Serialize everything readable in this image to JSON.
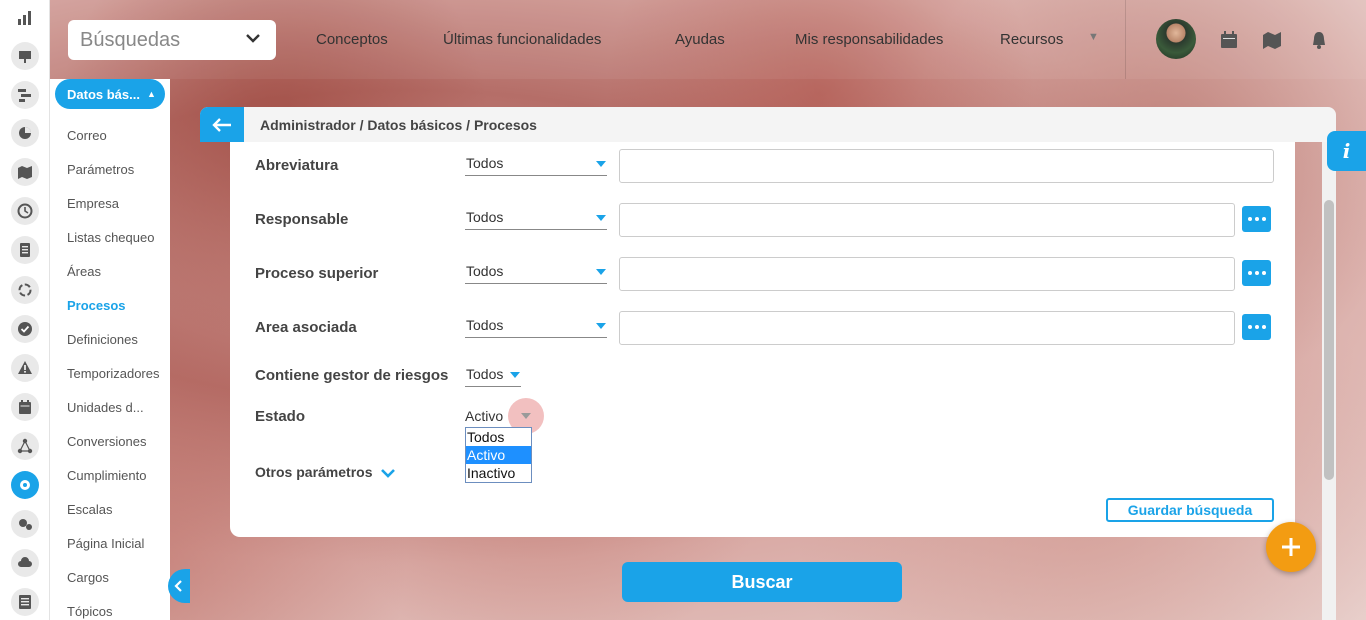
{
  "topbar": {
    "search_placeholder": "Búsquedas",
    "nav": [
      "Conceptos",
      "Últimas funcionalidades",
      "Ayudas",
      "Mis responsabilidades",
      "Recursos"
    ]
  },
  "submenu": {
    "section": "Datos bás...",
    "items": [
      "Correo",
      "Parámetros",
      "Empresa",
      "Listas chequeo",
      "Áreas",
      "Procesos",
      "Definiciones",
      "Temporizadores",
      "Unidades d...",
      "Conversiones",
      "Cumplimiento",
      "Escalas",
      "Página Inicial",
      "Cargos",
      "Tópicos"
    ],
    "current": "Procesos"
  },
  "breadcrumb": "Administrador / Datos básicos / Procesos",
  "form": {
    "fields": [
      {
        "label": "Abreviatura",
        "filter": "Todos",
        "value": ""
      },
      {
        "label": "Responsable",
        "filter": "Todos",
        "value": ""
      },
      {
        "label": "Proceso superior",
        "filter": "Todos",
        "value": ""
      },
      {
        "label": "Area asociada",
        "filter": "Todos",
        "value": ""
      }
    ],
    "risk_manager": {
      "label": "Contiene gestor de riesgos",
      "filter": "Todos"
    },
    "estado": {
      "label": "Estado",
      "value": "Activo",
      "options": [
        "Todos",
        "Activo",
        "Inactivo"
      ]
    },
    "other_params": "Otros parámetros",
    "save_search": "Guardar búsqueda",
    "search": "Buscar"
  },
  "info_label": "i",
  "colors": {
    "accent": "#1aa3e8",
    "fab": "#f39c12",
    "selected": "#1e90ff"
  }
}
